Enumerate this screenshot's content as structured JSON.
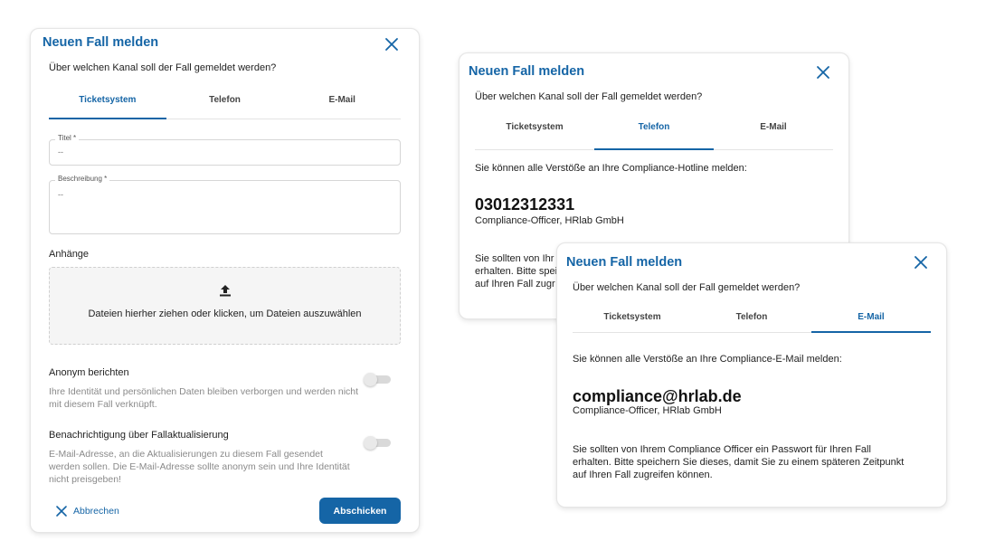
{
  "colors": {
    "accent": "#1565a6",
    "muted_text": "#8a8a8a",
    "dropzone_bg": "#f5f5f5"
  },
  "left_dialog": {
    "title": "Neuen Fall melden",
    "close_icon": "close-icon",
    "question": "Über welchen Kanal soll der Fall gemeldet werden?",
    "tabs": [
      "Ticketsystem",
      "Telefon",
      "E-Mail"
    ],
    "active_tab": "Ticketsystem",
    "title_field": {
      "label": "Titel *",
      "placeholder": "--"
    },
    "description_field": {
      "label": "Beschreibung *",
      "placeholder": "--"
    },
    "attachments_label": "Anhänge",
    "upload_icon": "upload-icon",
    "dropzone_text": "Dateien hierher ziehen oder klicken, um Dateien auszuwählen",
    "anonymous": {
      "label": "Anonym berichten",
      "description": "Ihre Identität und persönlichen Daten bleiben verborgen und werden nicht mit diesem Fall verknüpft.",
      "enabled": false
    },
    "notification": {
      "label": "Benachrichtigung über Fallaktualisierung",
      "description": "E-Mail-Adresse, an die Aktualisierungen zu diesem Fall gesendet werden sollen. Die E-Mail-Adresse sollte anonym sein und Ihre Identität nicht preisgeben!",
      "enabled": false
    },
    "cancel_label": "Abbrechen",
    "submit_label": "Abschicken"
  },
  "phone_dialog": {
    "title": "Neuen Fall melden",
    "question": "Über welchen Kanal soll der Fall gemeldet werden?",
    "tabs": [
      "Ticketsystem",
      "Telefon",
      "E-Mail"
    ],
    "active_tab": "Telefon",
    "intro": "Sie können alle Verstöße an Ihre Compliance-Hotline melden:",
    "phone_number": "03012312331",
    "officer": "Compliance-Officer, HRlab GmbH",
    "note_line1": "Sie sollten von Ihr",
    "note_line2": "erhalten. Bitte speich",
    "note_line3": "auf Ihren Fall zugr"
  },
  "email_dialog": {
    "title": "Neuen Fall melden",
    "question": "Über welchen Kanal soll der Fall gemeldet werden?",
    "tabs": [
      "Ticketsystem",
      "Telefon",
      "E-Mail"
    ],
    "active_tab": "E-Mail",
    "intro": "Sie können alle Verstöße an Ihre Compliance-E-Mail melden:",
    "email": "compliance@hrlab.de",
    "officer": "Compliance-Officer, HRlab GmbH",
    "note": "Sie sollten von Ihrem Compliance Officer ein Passwort für Ihren Fall erhalten. Bitte speichern Sie dieses, damit Sie zu einem späteren Zeitpunkt auf Ihren Fall zugreifen können."
  }
}
